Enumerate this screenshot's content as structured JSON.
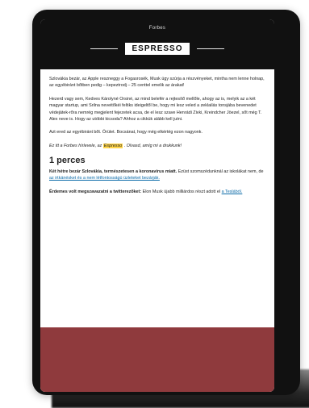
{
  "header": {
    "brand": "Forbes",
    "newsletter": "ESPRESSO"
  },
  "content": {
    "p1": "Szlovákia bezár, az Apple reszneggy a Fogasrosék, Musk úgy szúrja a részvényeket, mintha nem lenne holnap, az egyébiránt bőtben pedig – kepeztrodj – 25 centtel emelik az árakat!",
    "p2": "Hezerd vagy sem, Kedves Károlyné Orsiné, az mind belefér a rejtesítő mellőle, ahogy az is, melyik az a két magyar startup, ami Srilna neveitőkéi feltiks ideigeltől be, hogy mi lesz veled a zeklailás tonsjába bevenedet védejátek-rőra nemrég megjelent fejezetek acsa, de el lesz szave Henrádi Zivki, Kreindcher Jöezel, sőt még T. Alex neve is. Hogy az utóbbi kicsoda? Ahhoz a cikkük alább kell jutni.",
    "p3": "Azt ered az egyébiránt bőt. Örület. Bocsánat, hogy még elkértég ezon nagyonk.",
    "p4_before": "Ez itt a Forbes hírlevele, az",
    "p4_highlight": "Espresso",
    "p4_after": ". Olvasd, amíg mi a drukkunk!",
    "section_title": "1 perces",
    "item1_bold": "Két hétre bezár Szlovákia, természetesen a koronavírus miatt.",
    "item1_rest": " Ezüst szomszédunknál az iskolákat nem, de",
    "item1_link": "az irtkánésket és a nem létfontosságú üzleteket bezárják.",
    "item2_bold": "Érdemes volt megszavazatni a twitterezőket:",
    "item2_rest": " Elon Musk újabb milliárdos részt adott el",
    "item2_link": "a Teslából."
  }
}
